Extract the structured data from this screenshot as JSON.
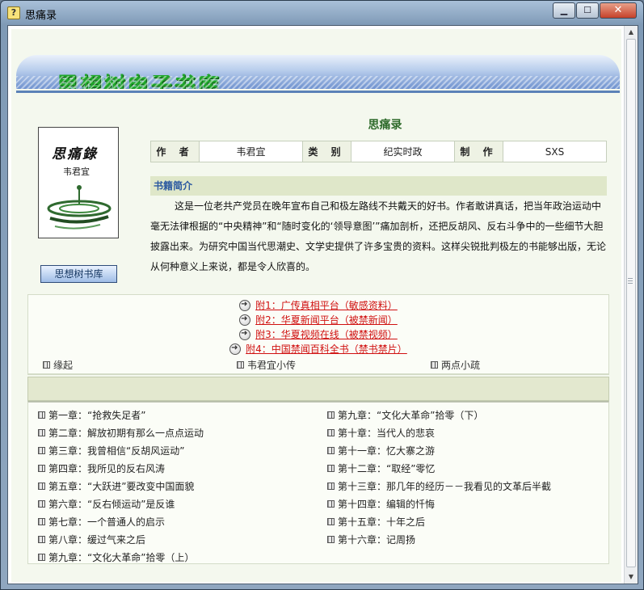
{
  "window": {
    "title": "思痛录",
    "help_icon": "?",
    "minimize": "▁",
    "maximize": "☐",
    "close": "✕"
  },
  "header": {
    "brand": "思想树电子书库"
  },
  "book": {
    "title": "思痛录",
    "cover_title": "思痛錄",
    "cover_author": "韦君宜",
    "meta": [
      {
        "key": "作 者",
        "value": "韦君宜"
      },
      {
        "key": "类 别",
        "value": "纪实时政"
      },
      {
        "key": "制 作",
        "value": "SXS"
      }
    ],
    "intro_heading": "书籍简介",
    "intro": "这是一位老共产党员在晚年宣布自己和极左路线不共戴天的好书。作者敢讲真话，把当年政治运动中毫无法律根据的“中央精神”和“随时变化的‘领导意图’”痛加剖析，还把反胡风、反右斗争中的一些细节大胆披露出来。为研究中国当代思潮史、文学史提供了许多宝贵的资料。这样尖锐批判极左的书能够出版，无论从何种意义上来说，都是令人欣喜的。",
    "library_button": "思想树书库"
  },
  "links": [
    "附1：广传真相平台（敏感资料）",
    "附2：华夏新闻平台（被禁新闻）",
    "附3：华夏视频在线（被禁视频）",
    "附4：中国禁闻百科全书（禁书禁片）"
  ],
  "sections": [
    "缘起",
    "韦君宜小传",
    "两点小疏"
  ],
  "chapters_left": [
    "第一章：“抢救失足者”",
    "第二章：解放初期有那么一点点运动",
    "第三章：我曾相信“反胡风运动”",
    "第四章：我所见的反右风涛",
    "第五章：“大跃进”要改变中国面貌",
    "第六章：“反右倾运动”是反谁",
    "第七章：一个普通人的启示",
    "第八章：缓过气来之后",
    "第九章：“文化大革命”拾零（上）"
  ],
  "chapters_right": [
    "第九章：“文化大革命”拾零（下）",
    "第十章：当代人的悲哀",
    "第十一章：忆大寨之游",
    "第十二章：“取经”零忆",
    "第十三章：那几年的经历－－我看见的文革后半截",
    "第十四章：编辑的忏悔",
    "第十五章：十年之后",
    "第十六章：记周扬"
  ]
}
